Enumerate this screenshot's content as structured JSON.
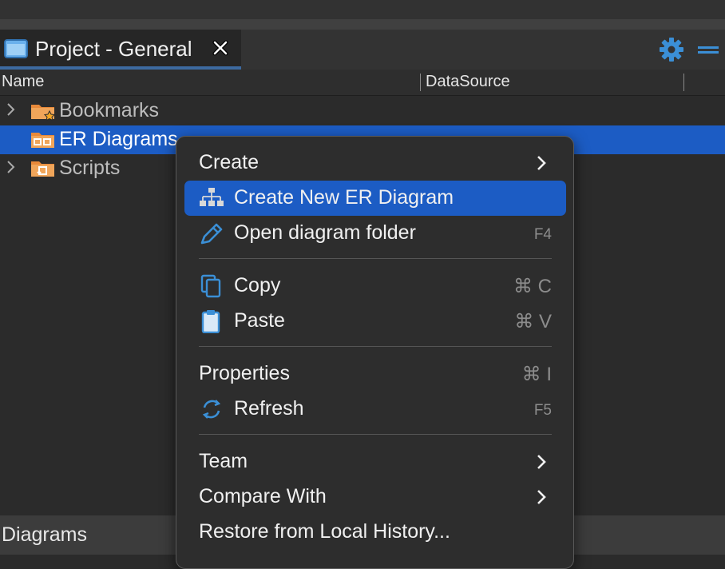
{
  "tab": {
    "title": "Project - General",
    "icon": "window-icon",
    "close_icon": "close-icon"
  },
  "toolbar": {
    "gear_icon": "gear-icon",
    "minimize_icon": "minimize-icon"
  },
  "columns": {
    "name": "Name",
    "datasource": "DataSource"
  },
  "tree": [
    {
      "label": "Bookmarks",
      "icon": "bookmarks-folder-icon",
      "expandable": true,
      "selected": false
    },
    {
      "label": "ER Diagrams",
      "icon": "er-diagrams-folder-icon",
      "expandable": false,
      "selected": true
    },
    {
      "label": "Scripts",
      "icon": "scripts-folder-icon",
      "expandable": true,
      "selected": false
    }
  ],
  "status": {
    "text": "Diagrams"
  },
  "menu": {
    "items": [
      {
        "label": "Create",
        "submenu": true
      },
      {
        "label": "Create New ER Diagram",
        "icon": "er-diagram-icon",
        "highlighted": true
      },
      {
        "label": "Open diagram folder",
        "icon": "pencil-icon",
        "shortcut": "F4"
      },
      {
        "label": "Copy",
        "icon": "copy-icon",
        "shortcut": "⌘ C"
      },
      {
        "label": "Paste",
        "icon": "clipboard-icon",
        "shortcut": "⌘ V"
      },
      {
        "label": "Properties",
        "shortcut": "⌘ I"
      },
      {
        "label": "Refresh",
        "icon": "refresh-icon",
        "shortcut": "F5"
      },
      {
        "label": "Team",
        "submenu": true
      },
      {
        "label": "Compare With",
        "submenu": true
      },
      {
        "label": "Restore from Local History..."
      }
    ]
  },
  "colors": {
    "selection": "#1c5cc4",
    "accent_icon": "#3b8fd6",
    "folder_orange": "#e8893a"
  }
}
